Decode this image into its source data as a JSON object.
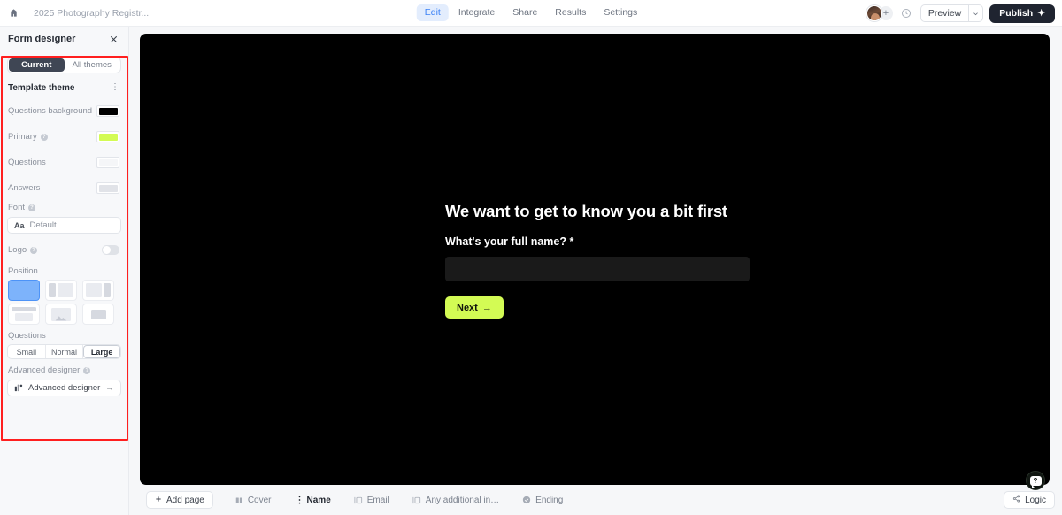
{
  "topbar": {
    "home_icon": "home-icon",
    "doc_title": "2025 Photography Registr...",
    "tabs": [
      {
        "label": "Edit",
        "active": true
      },
      {
        "label": "Integrate",
        "active": false
      },
      {
        "label": "Share",
        "active": false
      },
      {
        "label": "Results",
        "active": false
      },
      {
        "label": "Settings",
        "active": false
      }
    ],
    "add_label": "+",
    "history_icon": "clock-icon",
    "preview_label": "Preview",
    "preview_caret": "⌄",
    "publish_label": "Publish",
    "publish_icon": "✦"
  },
  "sidebar": {
    "panel_title": "Form designer",
    "close_icon": "close-icon",
    "theme_tabs": [
      {
        "label": "Current",
        "active": true
      },
      {
        "label": "All themes",
        "active": false
      }
    ],
    "section_title": "Template theme",
    "kebab": "⋮",
    "properties": [
      {
        "label": "Questions background",
        "info": false,
        "color": "#000000"
      },
      {
        "label": "Primary",
        "info": true,
        "color": "#d3fb54"
      },
      {
        "label": "Questions",
        "info": false,
        "color": "#f5f6f8"
      },
      {
        "label": "Answers",
        "info": false,
        "color": "#e1e3e8"
      }
    ],
    "font_label": "Font",
    "font_aa": "Aa",
    "font_value": "Default",
    "logo_label": "Logo",
    "logo_toggle": "off",
    "position_label": "Position",
    "position_tiles": [
      {
        "name": "position-full",
        "selected": true
      },
      {
        "name": "position-left-panel",
        "selected": false
      },
      {
        "name": "position-right-panel",
        "selected": false
      },
      {
        "name": "position-top-panel",
        "selected": false
      },
      {
        "name": "position-image",
        "selected": false
      },
      {
        "name": "position-center",
        "selected": false
      }
    ],
    "questions_label": "Questions",
    "question_sizes": [
      {
        "label": "Small",
        "active": false
      },
      {
        "label": "Normal",
        "active": false
      },
      {
        "label": "Large",
        "active": true
      }
    ],
    "advanced_label": "Advanced designer",
    "advanced_button": "Advanced designer",
    "advanced_arrow": "→",
    "highlight_color": "#ff1f1f"
  },
  "canvas": {
    "background": "#000000",
    "heading": "We want to get to know you a bit first",
    "question": "What's your full name?",
    "required_mark": "*",
    "input_value": "",
    "input_placeholder": "",
    "next_label": "Next",
    "next_arrow": "→",
    "next_color": "#d3fb54"
  },
  "bottombar": {
    "add_page": "Add page",
    "pages": [
      {
        "label": "Cover",
        "icon": "cover-icon",
        "active": false
      },
      {
        "label": "Name",
        "icon": "drag-handle-icon",
        "active": true
      },
      {
        "label": "Email",
        "icon": "field-icon",
        "active": false
      },
      {
        "label": "Any additional in…",
        "icon": "field-icon",
        "active": false
      },
      {
        "label": "Ending",
        "icon": "check-circle-icon",
        "active": false
      }
    ],
    "logic_label": "Logic",
    "help_icon": "help-icon"
  }
}
